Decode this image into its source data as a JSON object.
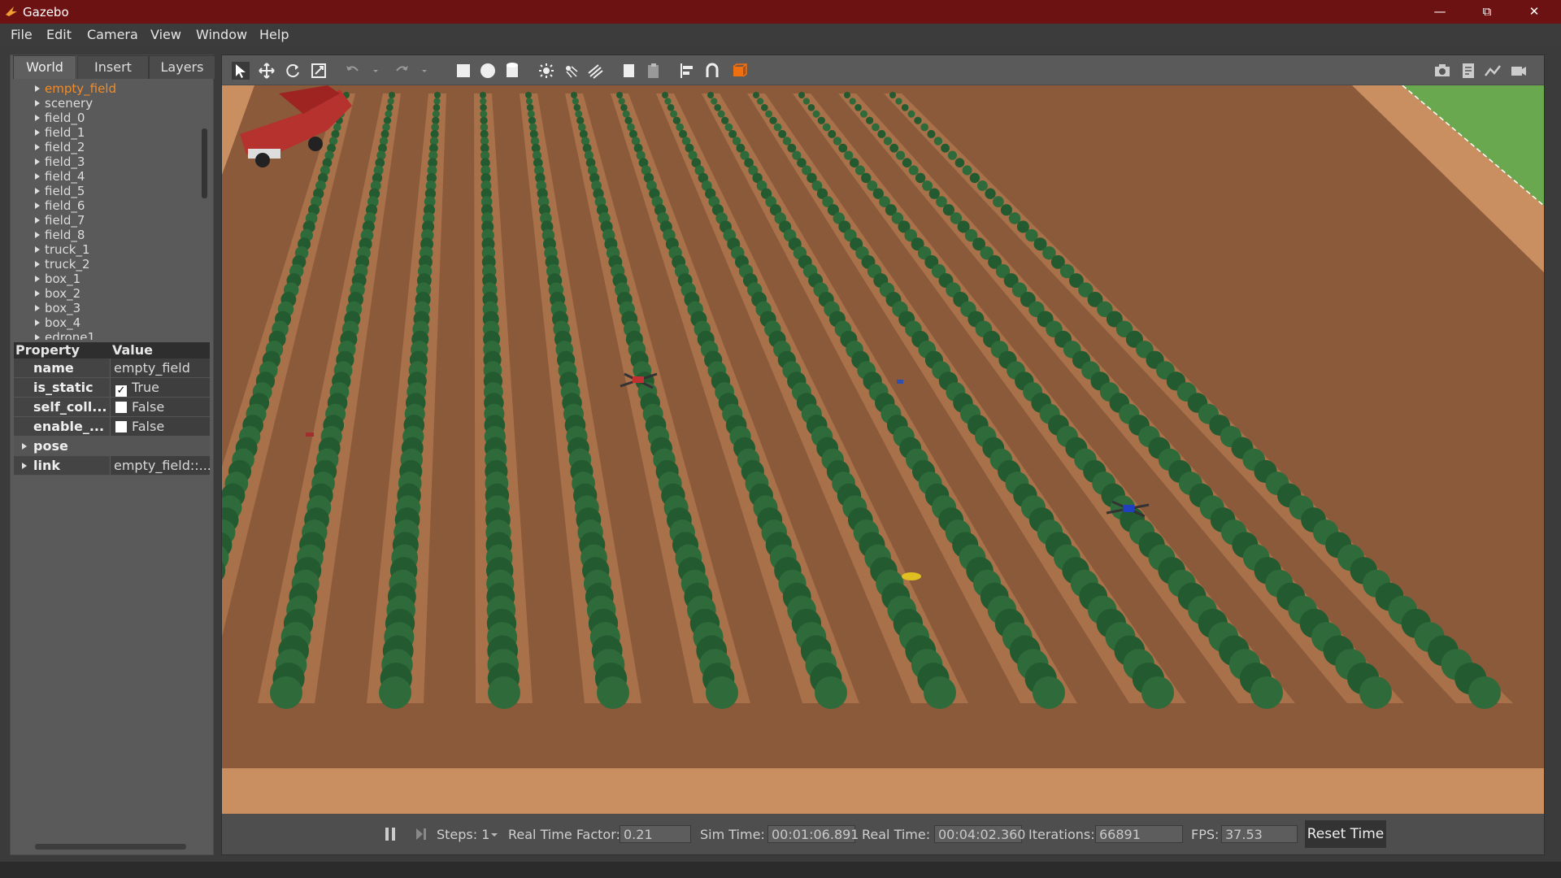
{
  "window": {
    "title": "Gazebo"
  },
  "menu": [
    "File",
    "Edit",
    "Camera",
    "View",
    "Window",
    "Help"
  ],
  "tabs": [
    "World",
    "Insert",
    "Layers"
  ],
  "tree": [
    "empty_field",
    "scenery",
    "field_0",
    "field_1",
    "field_2",
    "field_3",
    "field_4",
    "field_5",
    "field_6",
    "field_7",
    "field_8",
    "truck_1",
    "truck_2",
    "box_1",
    "box_2",
    "box_3",
    "box_4",
    "edrone1"
  ],
  "properties": {
    "header": {
      "property": "Property",
      "value": "Value"
    },
    "rows": [
      {
        "key": "name",
        "value": "empty_field"
      },
      {
        "key": "is_static",
        "value": "True",
        "checked": true
      },
      {
        "key": "self_coll...",
        "value": "False",
        "checked": false
      },
      {
        "key": "enable_...",
        "value": "False",
        "checked": false
      },
      {
        "key": "pose",
        "value": ""
      },
      {
        "key": "link",
        "value": "empty_field::..."
      }
    ]
  },
  "bottom": {
    "steps_label": "Steps: 1",
    "rtf_label": "Real Time Factor:",
    "rtf_value": "0.21",
    "sim_label": "Sim Time:",
    "sim_value": "00:01:06.891",
    "real_label": "Real Time:",
    "real_value": "00:04:02.360",
    "iter_label": "Iterations:",
    "iter_value": "66891",
    "fps_label": "FPS:",
    "fps_value": "37.53",
    "reset_label": "Reset Time"
  }
}
